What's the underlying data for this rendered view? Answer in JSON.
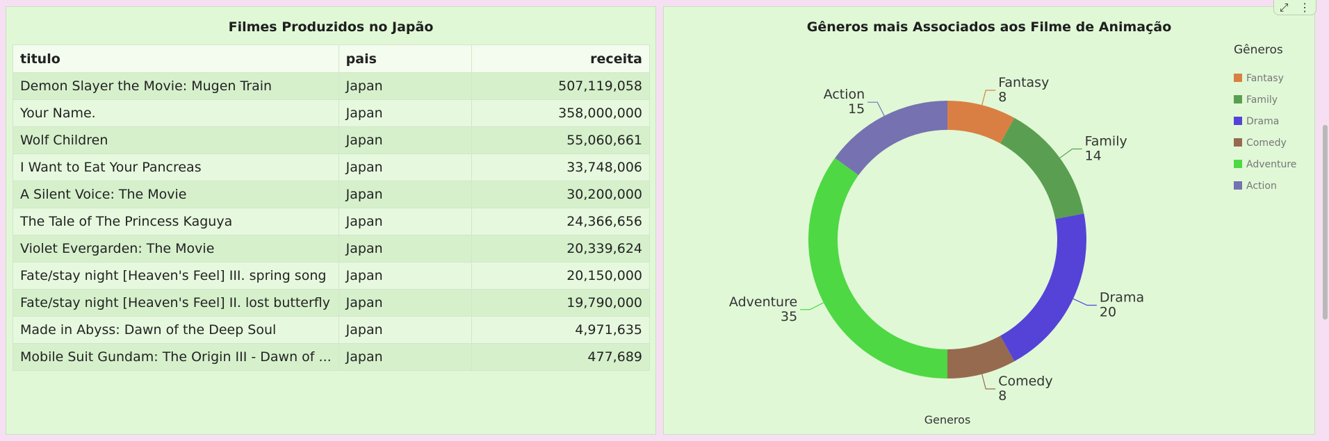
{
  "table_panel": {
    "title": "Filmes Produzidos no Japão",
    "headers": [
      "titulo",
      "pais",
      "receita"
    ],
    "rows": [
      [
        "Demon Slayer the Movie: Mugen Train",
        "Japan",
        "507,119,058"
      ],
      [
        "Your Name.",
        "Japan",
        "358,000,000"
      ],
      [
        "Wolf Children",
        "Japan",
        "55,060,661"
      ],
      [
        "I Want to Eat Your Pancreas",
        "Japan",
        "33,748,006"
      ],
      [
        "A Silent Voice: The Movie",
        "Japan",
        "30,200,000"
      ],
      [
        "The Tale of The Princess Kaguya",
        "Japan",
        "24,366,656"
      ],
      [
        "Violet Evergarden: The Movie",
        "Japan",
        "20,339,624"
      ],
      [
        "Fate/stay night [Heaven's Feel] III. spring song",
        "Japan",
        "20,150,000"
      ],
      [
        "Fate/stay night [Heaven's Feel] II. lost butterfly",
        "Japan",
        "19,790,000"
      ],
      [
        "Made in Abyss: Dawn of the Deep Soul",
        "Japan",
        "4,971,635"
      ],
      [
        "Mobile Suit Gundam: The Origin III - Dawn of ...",
        "Japan",
        "477,689"
      ]
    ]
  },
  "chart_panel": {
    "title": "Gêneros mais Associados aos Filme de Animação",
    "xlabel": "Generos"
  },
  "toolbar": {
    "expand_icon": "expand-icon",
    "more_icon": "more-vertical-icon"
  },
  "chart_data": {
    "type": "pie",
    "donut": true,
    "title": "Gêneros mais Associados aos Filme de Animação",
    "xlabel": "Generos",
    "legend_title": "Gêneros",
    "legend_position": "top-right",
    "categories": [
      "Fantasy",
      "Family",
      "Drama",
      "Comedy",
      "Adventure",
      "Action"
    ],
    "values": [
      8,
      14,
      20,
      8,
      35,
      15
    ],
    "colors": [
      "#d97f43",
      "#5a9e52",
      "#5543d8",
      "#966a4f",
      "#4ed844",
      "#7671b1"
    ]
  }
}
